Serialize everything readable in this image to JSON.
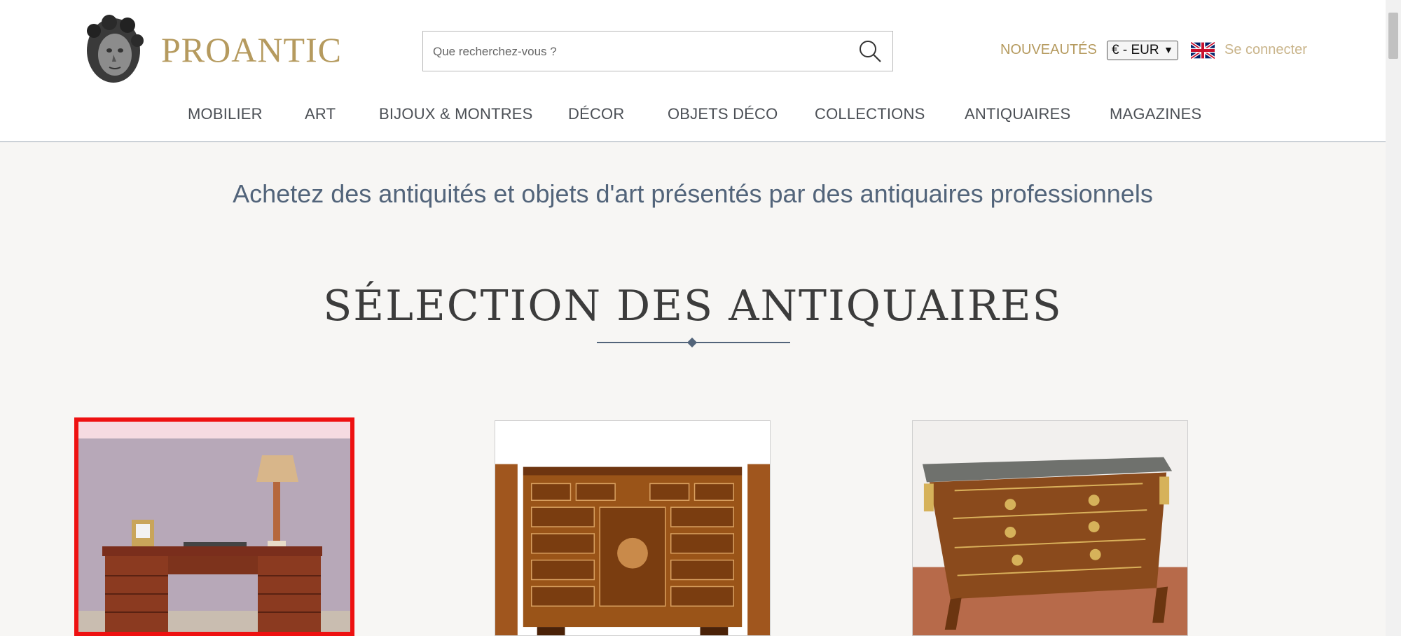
{
  "header": {
    "logo_text": "PROANTIC",
    "search_placeholder": "Que recherchez-vous ?",
    "nouveautes_label": "NOUVEAUTÉS",
    "currency_value": "€ - EUR",
    "language_flag": "uk-flag-icon",
    "login_label": "Se connecter"
  },
  "nav": {
    "items": [
      {
        "label": "MOBILIER"
      },
      {
        "label": "ART"
      },
      {
        "label": "BIJOUX & MONTRES"
      },
      {
        "label": "DÉCOR"
      },
      {
        "label": "OBJETS DÉCO"
      },
      {
        "label": "COLLECTIONS"
      },
      {
        "label": "ANTIQUAIRES"
      },
      {
        "label": "MAGAZINES"
      }
    ]
  },
  "main": {
    "tagline": "Achetez des antiquités et objets d'art présentés par des antiquaires professionnels",
    "section_title": "SÉLECTION DES ANTIQUAIRES",
    "cards": [
      {
        "image": "mahogany-desk-with-lamp-image",
        "highlighted": true
      },
      {
        "image": "inlaid-cabinet-image",
        "highlighted": false
      },
      {
        "image": "marble-top-commode-image",
        "highlighted": false
      }
    ]
  },
  "colors": {
    "brand_gold": "#b59a5e",
    "text_blue": "#52647a",
    "highlight_red": "#ee1111"
  }
}
